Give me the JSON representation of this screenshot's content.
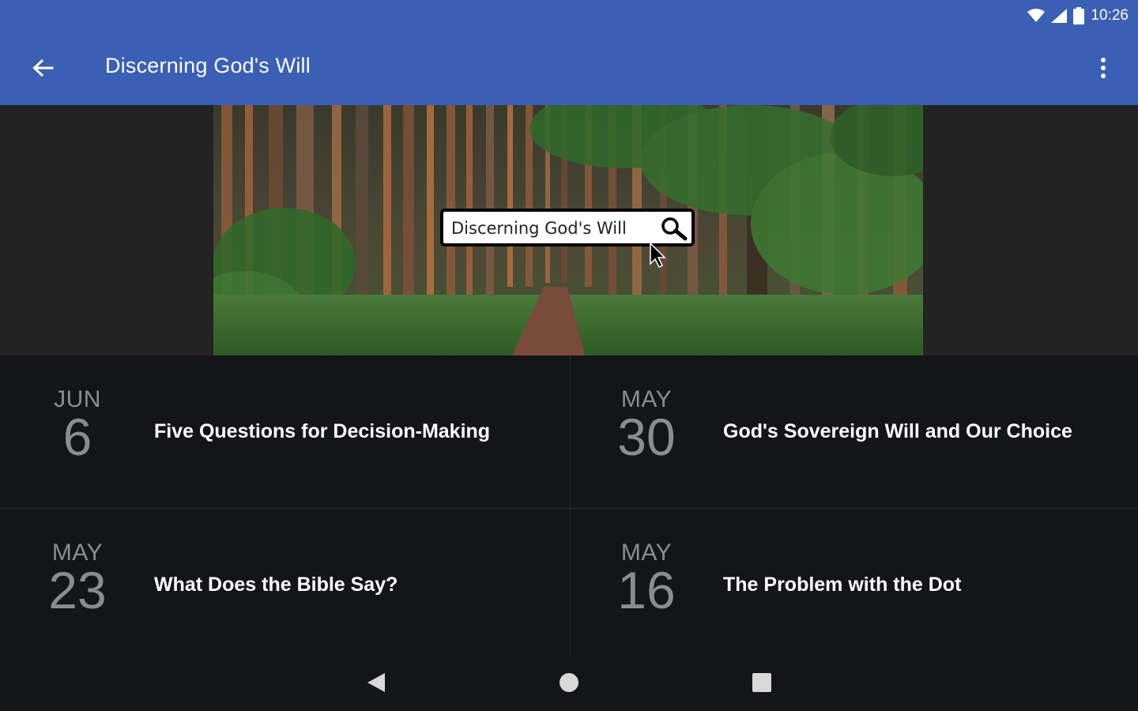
{
  "status_bar": {
    "time": "10:26",
    "icons": [
      "wifi-icon",
      "cell-signal-icon",
      "battery-icon"
    ]
  },
  "app_bar": {
    "title": "Discerning God's Will",
    "back_icon": "arrow-left-icon",
    "menu_icon": "more-vert-icon",
    "color": "#3a5fb5"
  },
  "hero": {
    "search_text": "Discerning God's Will",
    "search_icon": "magnifier-icon"
  },
  "episodes": [
    {
      "month": "JUN",
      "day": "6",
      "title": "Five Questions for Decision-Making"
    },
    {
      "month": "MAY",
      "day": "30",
      "title": "God's Sovereign Will and Our Choice"
    },
    {
      "month": "MAY",
      "day": "23",
      "title": "What Does the Bible Say?"
    },
    {
      "month": "MAY",
      "day": "16",
      "title": "The Problem with the Dot"
    }
  ],
  "nav": {
    "icons": [
      "back-triangle-icon",
      "home-circle-icon",
      "recents-square-icon"
    ]
  }
}
